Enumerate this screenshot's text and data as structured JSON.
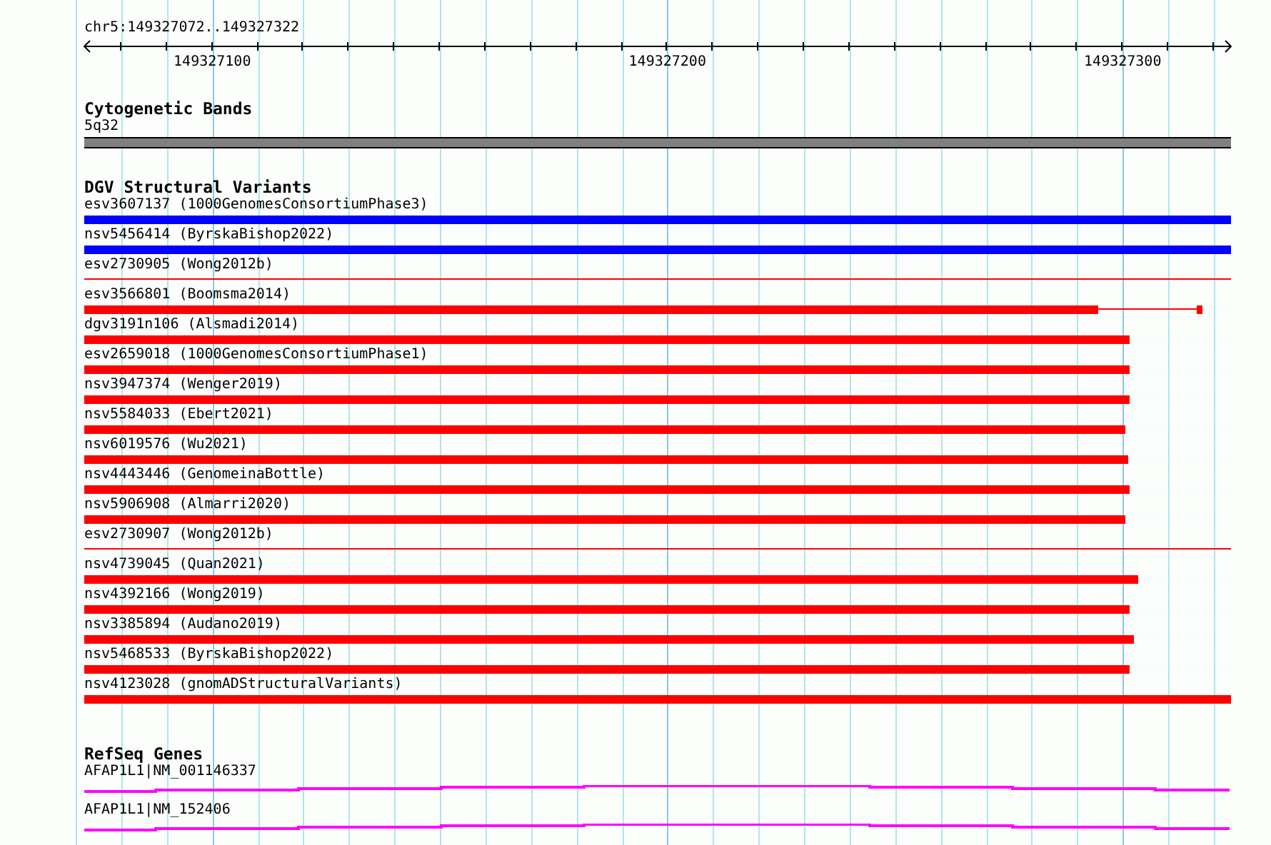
{
  "ruler": {
    "location": "chr5:149327072..149327322",
    "ticks": [
      "149327100",
      "149327200",
      "149327300"
    ]
  },
  "tracks": [
    {
      "kind": "bands",
      "title": "Cytogenetic Bands",
      "features": [
        {
          "label": "5q32"
        }
      ]
    },
    {
      "kind": "variants",
      "title": "DGV Structural Variants",
      "features": [
        {
          "label": "esv3607137 (1000GenomesConsortiumPhase3)",
          "color": "#0000ff",
          "segments": [
            {
              "kind": "thick",
              "level": 1
            }
          ]
        },
        {
          "label": "nsv5456414 (ByrskaBishop2022)",
          "color": "#0000ff",
          "segments": [
            {
              "kind": "thick",
              "level": 1
            }
          ]
        },
        {
          "label": "esv2730905 (Wong2012b)",
          "color": "#ff0000",
          "segments": [
            {
              "kind": "line",
              "level": 1
            }
          ]
        },
        {
          "label": "esv3566801 (Boomsma2014)",
          "color": "#ff0000",
          "segments": [
            {
              "kind": "thick",
              "level": 0.884
            },
            {
              "kind": "line",
              "level": 0.97
            },
            {
              "kind": "thick",
              "level": 0.975
            }
          ]
        },
        {
          "label": "dgv3191n106 (Alsmadi2014)",
          "color": "#ff0000",
          "segments": [
            {
              "kind": "thick",
              "level": 0.912
            }
          ]
        },
        {
          "label": "esv2659018 (1000GenomesConsortiumPhase1)",
          "color": "#ff0000",
          "segments": [
            {
              "kind": "thick",
              "level": 0.912
            }
          ]
        },
        {
          "label": "nsv3947374 (Wenger2019)",
          "color": "#ff0000",
          "segments": [
            {
              "kind": "thick",
              "level": 0.912
            }
          ]
        },
        {
          "label": "nsv5584033 (Ebert2021)",
          "color": "#ff0000",
          "segments": [
            {
              "kind": "thick",
              "level": 0.908
            }
          ]
        },
        {
          "label": "nsv6019576 (Wu2021)",
          "color": "#ff0000",
          "segments": [
            {
              "kind": "thick",
              "level": 0.91
            }
          ]
        },
        {
          "label": "nsv4443446 (GenomeinaBottle)",
          "color": "#ff0000",
          "segments": [
            {
              "kind": "thick",
              "level": 0.912
            }
          ]
        },
        {
          "label": "nsv5906908 (Almarri2020)",
          "color": "#ff0000",
          "segments": [
            {
              "kind": "thick",
              "level": 0.908
            }
          ]
        },
        {
          "label": "esv2730907 (Wong2012b)",
          "color": "#ff0000",
          "segments": [
            {
              "kind": "line",
              "level": 1
            }
          ]
        },
        {
          "label": "nsv4739045 (Quan2021)",
          "color": "#ff0000",
          "segments": [
            {
              "kind": "thick",
              "level": 0.919
            }
          ]
        },
        {
          "label": "nsv4392166 (Wong2019)",
          "color": "#ff0000",
          "segments": [
            {
              "kind": "thick",
              "level": 0.912
            }
          ]
        },
        {
          "label": "nsv3385894 (Audano2019)",
          "color": "#ff0000",
          "segments": [
            {
              "kind": "thick",
              "level": 0.915
            }
          ]
        },
        {
          "label": "nsv5468533 (ByrskaBishop2022)",
          "color": "#ff0000",
          "segments": [
            {
              "kind": "thick",
              "level": 0.912
            }
          ]
        },
        {
          "label": "nsv4123028 (gnomADStructuralVariants)",
          "color": "#ff0000",
          "segments": [
            {
              "kind": "thick",
              "level": 1
            }
          ]
        }
      ]
    },
    {
      "kind": "genes",
      "title": "RefSeq Genes",
      "features": [
        {
          "label": "AFAP1L1|NM_001146337"
        },
        {
          "label": "AFAP1L1|NM_152406"
        }
      ]
    }
  ]
}
